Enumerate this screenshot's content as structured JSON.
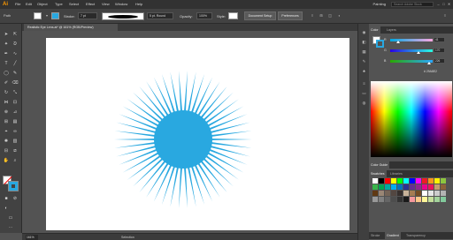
{
  "app": {
    "logo": "Ai"
  },
  "menu": [
    "File",
    "Edit",
    "Object",
    "Type",
    "Select",
    "Effect",
    "View",
    "Window",
    "Help"
  ],
  "workspace": {
    "label": "Painting",
    "search_placeholder": "Search Adobe Stock"
  },
  "control_bar": {
    "selection_label": "Path",
    "stroke_label": "Stroke:",
    "stroke_weight": "7 pt",
    "profile": "5 pt. Round",
    "opacity_label": "Opacity:",
    "opacity_value": "100%",
    "style_label": "Style:",
    "document_setup": "Document Setup",
    "preferences": "Preferences"
  },
  "document": {
    "tab_title": "Realistic Eye Lens.ai* @ 161% (RGB/Preview)"
  },
  "status": {
    "zoom": "161%",
    "tool": "Selection"
  },
  "artwork": {
    "fill_color": "#29a8e0",
    "ray_count": 50
  },
  "color_panel": {
    "tabs": [
      "Color",
      "Layers"
    ],
    "sliders": [
      {
        "key": "R",
        "value": "41"
      },
      {
        "key": "G",
        "value": "170"
      },
      {
        "key": "B",
        "value": "226"
      }
    ],
    "hex": "29A8E2",
    "hex_symbol": "#"
  },
  "color_guide_panel": {
    "tabs": [
      "Color Guide"
    ]
  },
  "swatches_panel": {
    "tabs": [
      "Swatches",
      "Libraries"
    ]
  },
  "bottom_panel": {
    "tabs": [
      "Stroke",
      "Gradient",
      "Transparency"
    ]
  },
  "colors": {
    "accent": "#29a8e0",
    "menubar": "#323232",
    "panel": "#535353"
  }
}
